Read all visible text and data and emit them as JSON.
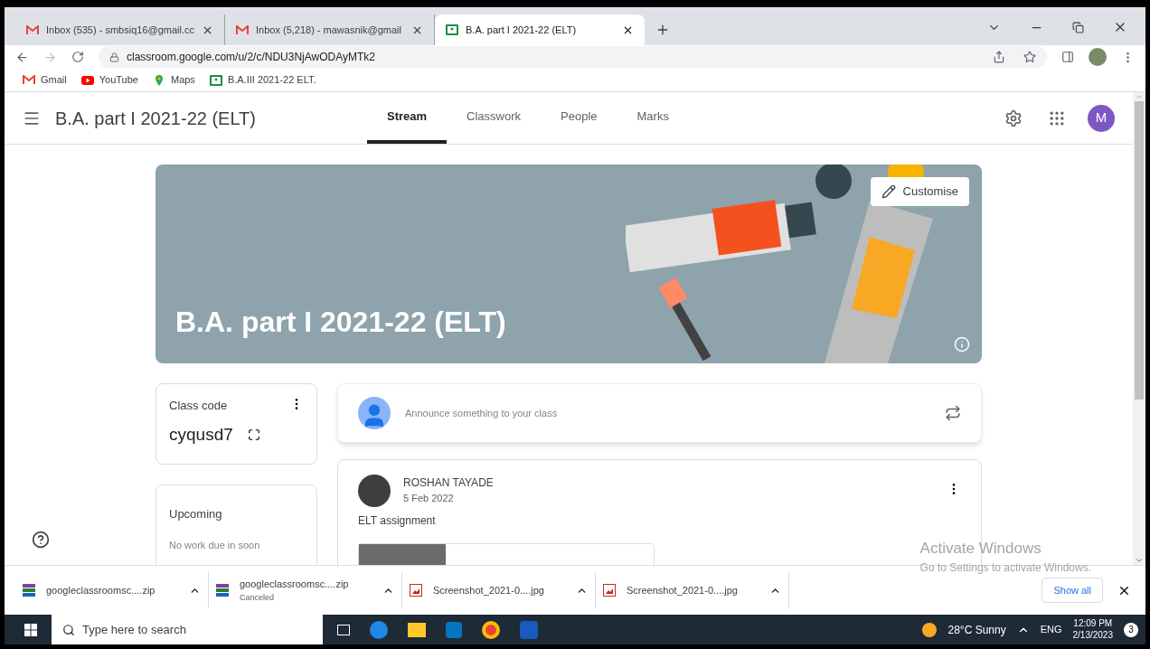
{
  "browser": {
    "tabs": [
      {
        "title": "Inbox (535) - smbsiq16@gmail.cc",
        "kind": "mail",
        "selected": false
      },
      {
        "title": "Inbox (5,218) - mawasnik@gmail",
        "kind": "mail",
        "selected": false
      },
      {
        "title": "B.A. part I 2021-22 (ELT)",
        "kind": "board",
        "selected": true
      }
    ],
    "address": "classroom.google.com/u/2/c/NDU3NjAwODAyMTk2",
    "bookmarks": [
      {
        "label": "Gmail",
        "kind": "mail"
      },
      {
        "label": "YouTube",
        "kind": "video"
      },
      {
        "label": "Maps",
        "kind": "map"
      },
      {
        "label": "B.A.III 2021-22 ELT.",
        "kind": "board"
      }
    ]
  },
  "classroom": {
    "title": "B.A. part I 2021-22 (ELT)",
    "nav": [
      {
        "label": "Stream",
        "selected": true
      },
      {
        "label": "Classwork",
        "selected": false
      },
      {
        "label": "People",
        "selected": false
      },
      {
        "label": "Marks",
        "selected": false
      }
    ],
    "avatar": "M"
  },
  "banner": {
    "title": "B.A. part I 2021-22 (ELT)",
    "customise": "Customise"
  },
  "class_code": {
    "label": "Class code",
    "code": "cyqusd7"
  },
  "upcoming": {
    "title": "Upcoming",
    "text": "No work due in soon"
  },
  "announce": {
    "placeholder": "Announce something to your class"
  },
  "post": {
    "author": "ROSHAN TAYADE",
    "date": "5 Feb 2022",
    "text": "ELT assignment"
  },
  "system_notice": {
    "title": "Activate Windows",
    "text": "Go to Settings to activate Windows."
  },
  "downloads": {
    "items": [
      {
        "name": "googleclassroomsc....zip",
        "kind": "zip"
      },
      {
        "name": "googleclassroomsc....zip",
        "status": "Canceled",
        "kind": "zip"
      },
      {
        "name": "Screenshot_2021-0....jpg",
        "kind": "image"
      },
      {
        "name": "Screenshot_2021-0....jpg",
        "kind": "image"
      }
    ],
    "show_all": "Show all"
  },
  "taskbar": {
    "search": "Type here to search",
    "weather": "28°C Sunny",
    "language": "ENG",
    "time": "12:09 PM",
    "date": "2/13/2023",
    "notifications": "3"
  }
}
